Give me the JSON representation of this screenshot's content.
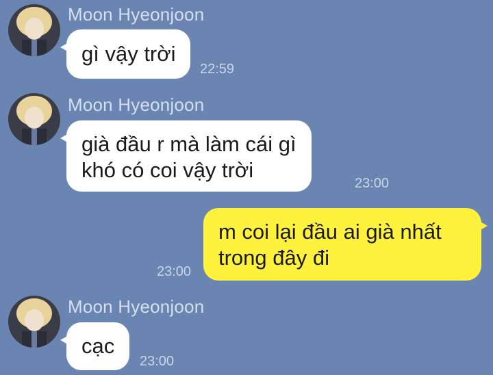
{
  "chat": {
    "messages": [
      {
        "direction": "incoming",
        "sender": "Moon Hyeonjoon",
        "lines": [
          "gì vậy trời"
        ],
        "time": "22:59"
      },
      {
        "direction": "incoming",
        "sender": "Moon Hyeonjoon",
        "lines": [
          "già đầu r mà làm cái gì",
          "khó có coi vậy trời"
        ],
        "time": "23:00"
      },
      {
        "direction": "outgoing",
        "lines": [
          "m coi lại đầu ai già nhất",
          "trong đây đi"
        ],
        "time": "23:00"
      },
      {
        "direction": "incoming",
        "sender": "Moon Hyeonjoon",
        "lines": [
          "cạc"
        ],
        "time": "23:00"
      }
    ]
  },
  "colors": {
    "background": "#6a85b2",
    "incoming_bubble": "#ffffff",
    "outgoing_bubble": "#fff23c",
    "meta_text": "#d4dff0"
  }
}
